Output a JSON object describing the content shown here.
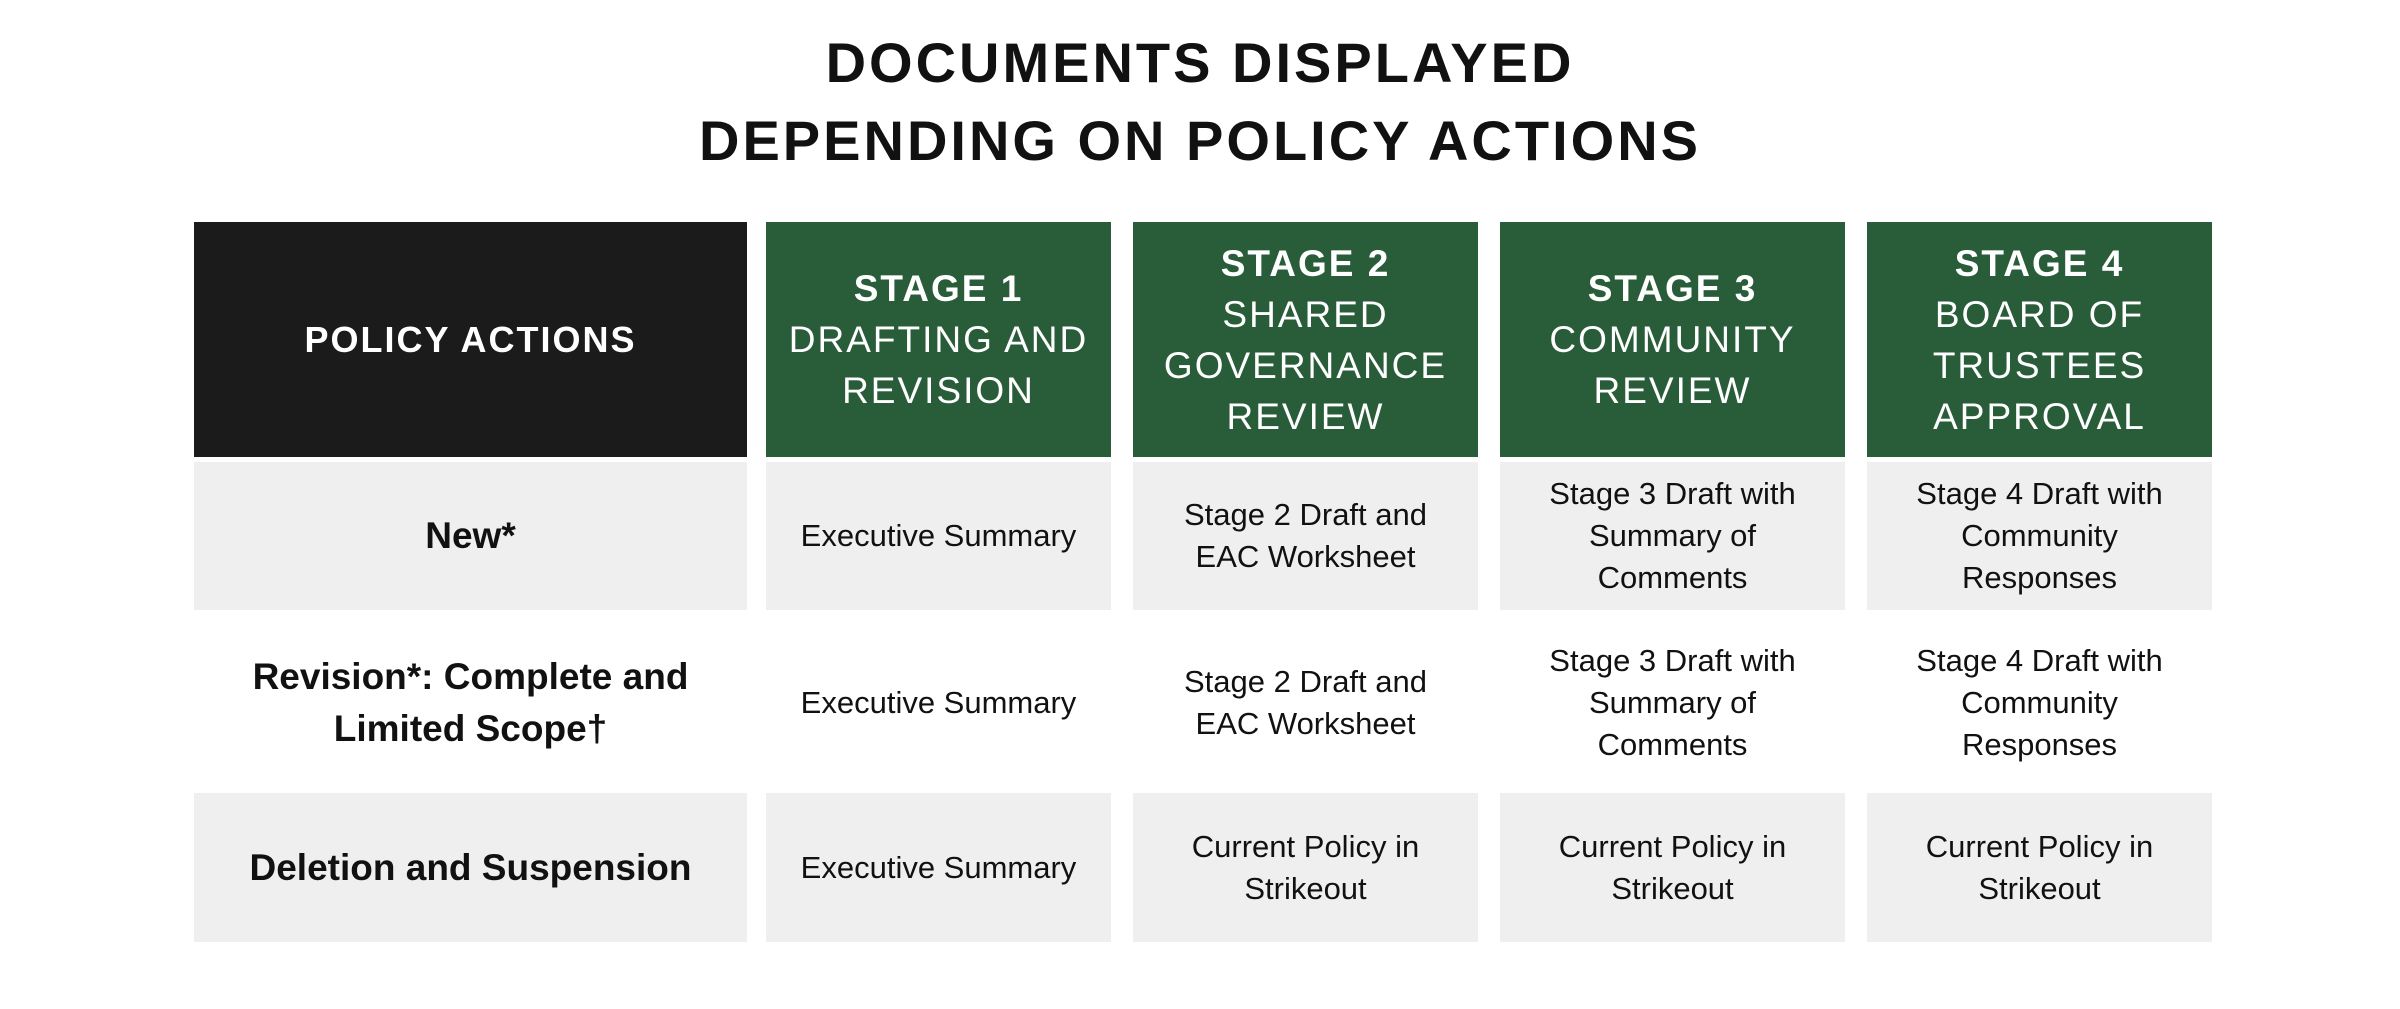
{
  "title": {
    "line1": "DOCUMENTS DISPLAYED",
    "line2": "DEPENDING ON POLICY ACTIONS"
  },
  "colors": {
    "header_black": "#1b1b1b",
    "header_green": "#295d3a",
    "row_gray": "#efefef"
  },
  "table": {
    "corner_header": "POLICY ACTIONS",
    "stages": [
      {
        "stage": "STAGE 1",
        "name_lines": [
          "DRAFTING AND",
          "REVISION"
        ]
      },
      {
        "stage": "STAGE 2",
        "name_lines": [
          "SHARED",
          "GOVERNANCE",
          "REVIEW"
        ]
      },
      {
        "stage": "STAGE 3",
        "name_lines": [
          "COMMUNITY",
          "REVIEW"
        ]
      },
      {
        "stage": "STAGE 4",
        "name_lines": [
          "BOARD OF",
          "TRUSTEES",
          "APPROVAL"
        ]
      }
    ],
    "rows": [
      {
        "action_lines": [
          "New*"
        ],
        "cells": [
          [
            "Executive Summary"
          ],
          [
            "Stage 2 Draft and",
            "EAC Worksheet"
          ],
          [
            "Stage 3 Draft with",
            "Summary of",
            "Comments"
          ],
          [
            "Stage 4 Draft with",
            "Community",
            "Responses"
          ]
        ]
      },
      {
        "action_lines": [
          "Revision*: Complete and",
          "Limited Scope†"
        ],
        "cells": [
          [
            "Executive Summary"
          ],
          [
            "Stage 2 Draft and",
            "EAC Worksheet"
          ],
          [
            "Stage 3 Draft with",
            "Summary of",
            "Comments"
          ],
          [
            "Stage 4 Draft with",
            "Community",
            "Responses"
          ]
        ]
      },
      {
        "action_lines": [
          "Deletion and Suspension"
        ],
        "cells": [
          [
            "Executive Summary"
          ],
          [
            "Current Policy in",
            "Strikeout"
          ],
          [
            "Current Policy in",
            "Strikeout"
          ],
          [
            "Current Policy in",
            "Strikeout"
          ]
        ]
      }
    ]
  }
}
